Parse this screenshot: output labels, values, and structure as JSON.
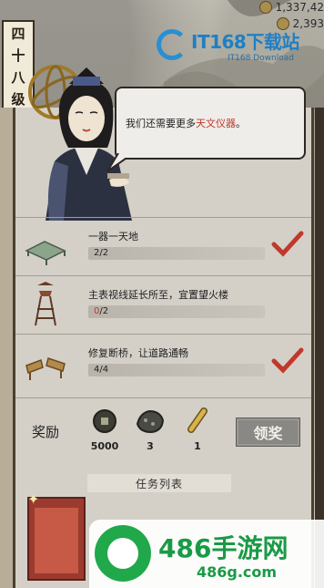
{
  "resources": [
    {
      "icon": "coin-icon",
      "value": "1,337,42"
    },
    {
      "icon": "coin-icon",
      "value": "2,393"
    }
  ],
  "level": {
    "chars": [
      "四",
      "十",
      "八",
      "级"
    ]
  },
  "watermark_top": {
    "main": "IT168下载站",
    "sub": "IT168 Download"
  },
  "dialog": {
    "text_before": "我们还需要更多",
    "highlight": "天文仪器",
    "text_after": "。"
  },
  "quests": [
    {
      "title": "一器一天地",
      "progress_done": "2",
      "progress_total": "/2",
      "completed": true,
      "icon": "bridge-platform-icon"
    },
    {
      "title": "主表视线延长所至，宜置望火楼",
      "progress_done": "0",
      "progress_total": "/2",
      "completed": false,
      "icon": "watchtower-icon"
    },
    {
      "title": "修复断桥，让道路通畅",
      "progress_done": "4/4",
      "progress_total": "",
      "completed": true,
      "icon": "broken-bridge-icon"
    }
  ],
  "reward": {
    "label": "奖励",
    "items": [
      {
        "icon": "coin-icon",
        "value": "5000"
      },
      {
        "icon": "ore-icon",
        "value": "3"
      },
      {
        "icon": "scroll-icon",
        "value": "1"
      }
    ],
    "claim_label": "领奖"
  },
  "task_list": {
    "header": "任务列表"
  },
  "watermark_bottom": {
    "big": "486手游网",
    "small": "486g.com"
  },
  "colors": {
    "highlight": "#c0392b",
    "check": "#c0392b",
    "watermark_green": "#1a9a46",
    "watermark_blue": "#1f7fc4"
  }
}
